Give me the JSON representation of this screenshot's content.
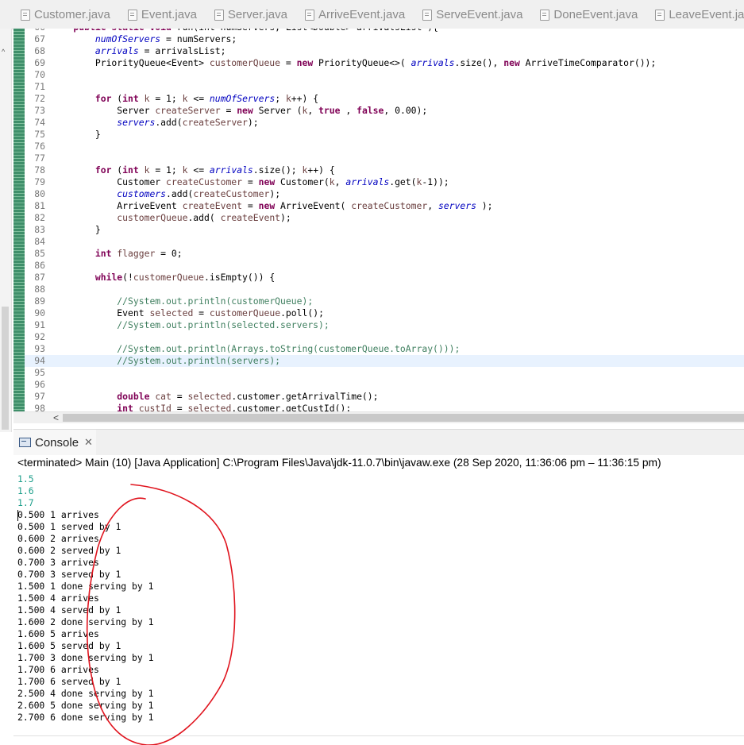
{
  "tabs": [
    {
      "label": "Customer.java",
      "icon": "java-file-icon"
    },
    {
      "label": "Event.java",
      "icon": "java-file-icon"
    },
    {
      "label": "Server.java",
      "icon": "java-file-icon"
    },
    {
      "label": "ArriveEvent.java",
      "icon": "java-file-icon"
    },
    {
      "label": "ServeEvent.java",
      "icon": "java-file-icon"
    },
    {
      "label": "DoneEvent.java",
      "icon": "java-file-icon"
    },
    {
      "label": "LeaveEvent.java",
      "icon": "java-file-icon"
    }
  ],
  "editor": {
    "highlighted_line": "94",
    "lines": [
      {
        "n": "66",
        "segs": [
          [
            "kw",
            "    public static void "
          ],
          [
            "",
            "run(int numServers, List<Double> arrivalsList ){"
          ]
        ]
      },
      {
        "n": "67",
        "segs": [
          [
            "",
            "        "
          ],
          [
            "fld",
            "numOfServers"
          ],
          [
            "",
            " = numServers;"
          ]
        ]
      },
      {
        "n": "68",
        "segs": [
          [
            "",
            "        "
          ],
          [
            "fld",
            "arrivals"
          ],
          [
            "",
            " = arrivalsList;"
          ]
        ]
      },
      {
        "n": "69",
        "segs": [
          [
            "",
            "        PriorityQueue<Event> "
          ],
          [
            "vr",
            "customerQueue"
          ],
          [
            "",
            " = "
          ],
          [
            "kw",
            "new"
          ],
          [
            "",
            " PriorityQueue<>( "
          ],
          [
            "fld",
            "arrivals"
          ],
          [
            "",
            ".size(), "
          ],
          [
            "kw",
            "new"
          ],
          [
            "",
            " ArriveTimeComparator());"
          ]
        ]
      },
      {
        "n": "70",
        "segs": []
      },
      {
        "n": "71",
        "segs": []
      },
      {
        "n": "72",
        "segs": [
          [
            "",
            "        "
          ],
          [
            "kw",
            "for"
          ],
          [
            "",
            " ("
          ],
          [
            "kw",
            "int"
          ],
          [
            "",
            " "
          ],
          [
            "vr",
            "k"
          ],
          [
            "",
            " = 1; "
          ],
          [
            "vr",
            "k"
          ],
          [
            "",
            " <= "
          ],
          [
            "fld",
            "numOfServers"
          ],
          [
            "",
            "; "
          ],
          [
            "vr",
            "k"
          ],
          [
            "",
            "++) {"
          ]
        ]
      },
      {
        "n": "73",
        "segs": [
          [
            "",
            "            Server "
          ],
          [
            "vr",
            "createServer"
          ],
          [
            "",
            " = "
          ],
          [
            "kw",
            "new"
          ],
          [
            "",
            " Server ("
          ],
          [
            "vr",
            "k"
          ],
          [
            "",
            ", "
          ],
          [
            "kw",
            "true"
          ],
          [
            "",
            " , "
          ],
          [
            "kw",
            "false"
          ],
          [
            "",
            ", 0.00);"
          ]
        ]
      },
      {
        "n": "74",
        "segs": [
          [
            "",
            "            "
          ],
          [
            "fld",
            "servers"
          ],
          [
            "",
            ".add("
          ],
          [
            "vr",
            "createServer"
          ],
          [
            "",
            ");"
          ]
        ]
      },
      {
        "n": "75",
        "segs": [
          [
            "",
            "        }"
          ]
        ]
      },
      {
        "n": "76",
        "segs": []
      },
      {
        "n": "77",
        "segs": []
      },
      {
        "n": "78",
        "segs": [
          [
            "",
            "        "
          ],
          [
            "kw",
            "for"
          ],
          [
            "",
            " ("
          ],
          [
            "kw",
            "int"
          ],
          [
            "",
            " "
          ],
          [
            "vr",
            "k"
          ],
          [
            "",
            " = 1; "
          ],
          [
            "vr",
            "k"
          ],
          [
            "",
            " <= "
          ],
          [
            "fld",
            "arrivals"
          ],
          [
            "",
            ".size(); "
          ],
          [
            "vr",
            "k"
          ],
          [
            "",
            "++) {"
          ]
        ]
      },
      {
        "n": "79",
        "segs": [
          [
            "",
            "            Customer "
          ],
          [
            "vr",
            "createCustomer"
          ],
          [
            "",
            " = "
          ],
          [
            "kw",
            "new"
          ],
          [
            "",
            " Customer("
          ],
          [
            "vr",
            "k"
          ],
          [
            "",
            ", "
          ],
          [
            "fld",
            "arrivals"
          ],
          [
            "",
            ".get("
          ],
          [
            "vr",
            "k"
          ],
          [
            "",
            "-1));"
          ]
        ]
      },
      {
        "n": "80",
        "segs": [
          [
            "",
            "            "
          ],
          [
            "fld",
            "customers"
          ],
          [
            "",
            ".add("
          ],
          [
            "vr",
            "createCustomer"
          ],
          [
            "",
            ");"
          ]
        ]
      },
      {
        "n": "81",
        "segs": [
          [
            "",
            "            ArriveEvent "
          ],
          [
            "vr",
            "createEvent"
          ],
          [
            "",
            " = "
          ],
          [
            "kw",
            "new"
          ],
          [
            "",
            " ArriveEvent( "
          ],
          [
            "vr",
            "createCustomer"
          ],
          [
            "",
            ", "
          ],
          [
            "fld",
            "servers"
          ],
          [
            "",
            " );"
          ]
        ]
      },
      {
        "n": "82",
        "segs": [
          [
            "",
            "            "
          ],
          [
            "vr",
            "customerQueue"
          ],
          [
            "",
            ".add( "
          ],
          [
            "vr",
            "createEvent"
          ],
          [
            "",
            ");"
          ]
        ]
      },
      {
        "n": "83",
        "segs": [
          [
            "",
            "        }"
          ]
        ]
      },
      {
        "n": "84",
        "segs": []
      },
      {
        "n": "85",
        "segs": [
          [
            "",
            "        "
          ],
          [
            "kw",
            "int"
          ],
          [
            "",
            " "
          ],
          [
            "vr",
            "flagger"
          ],
          [
            "",
            " = 0;"
          ]
        ]
      },
      {
        "n": "86",
        "segs": []
      },
      {
        "n": "87",
        "segs": [
          [
            "",
            "        "
          ],
          [
            "kw",
            "while"
          ],
          [
            "",
            "(!"
          ],
          [
            "vr",
            "customerQueue"
          ],
          [
            "",
            ".isEmpty()) {"
          ]
        ]
      },
      {
        "n": "88",
        "segs": []
      },
      {
        "n": "89",
        "segs": [
          [
            "",
            "            "
          ],
          [
            "cm",
            "//System.out.println(customerQueue);"
          ]
        ]
      },
      {
        "n": "90",
        "segs": [
          [
            "",
            "            Event "
          ],
          [
            "vr",
            "selected"
          ],
          [
            "",
            " = "
          ],
          [
            "vr",
            "customerQueue"
          ],
          [
            "",
            ".poll();"
          ]
        ]
      },
      {
        "n": "91",
        "segs": [
          [
            "",
            "            "
          ],
          [
            "cm",
            "//System.out.println(selected.servers);"
          ]
        ]
      },
      {
        "n": "92",
        "segs": []
      },
      {
        "n": "93",
        "segs": [
          [
            "",
            "            "
          ],
          [
            "cm",
            "//System.out.println(Arrays.toString(customerQueue.toArray()));"
          ]
        ]
      },
      {
        "n": "94",
        "segs": [
          [
            "",
            "            "
          ],
          [
            "cm",
            "//System.out.println(servers);"
          ]
        ]
      },
      {
        "n": "95",
        "segs": []
      },
      {
        "n": "96",
        "segs": []
      },
      {
        "n": "97",
        "segs": [
          [
            "",
            "            "
          ],
          [
            "kw",
            "double"
          ],
          [
            "",
            " "
          ],
          [
            "vr",
            "cat"
          ],
          [
            "",
            " = "
          ],
          [
            "vr",
            "selected"
          ],
          [
            "",
            ".customer.getArrivalTime();"
          ]
        ]
      },
      {
        "n": "98",
        "segs": [
          [
            "",
            "            "
          ],
          [
            "kw",
            "int"
          ],
          [
            "",
            " "
          ],
          [
            "vr",
            "custId"
          ],
          [
            "",
            " = "
          ],
          [
            "vr",
            "selected"
          ],
          [
            "",
            ".customer.getCustId();"
          ]
        ]
      }
    ]
  },
  "console": {
    "title": "Console",
    "close_glyph": "✕",
    "status": "<terminated> Main (10) [Java Application] C:\\Program Files\\Java\\jdk-11.0.7\\bin\\javaw.exe  (28 Sep 2020, 11:36:06 pm – 11:36:15 pm)",
    "input_lines": [
      "1.5",
      "1.6",
      "1.7"
    ],
    "output_lines": [
      "0.500 1 arrives",
      "0.500 1 served by 1",
      "0.600 2 arrives",
      "0.600 2 served by 1",
      "0.700 3 arrives",
      "0.700 3 served by 1",
      "1.500 1 done serving by 1",
      "1.500 4 arrives",
      "1.500 4 served by 1",
      "1.600 2 done serving by 1",
      "1.600 5 arrives",
      "1.600 5 served by 1",
      "1.700 3 done serving by 1",
      "1.700 6 arrives",
      "1.700 6 served by 1",
      "2.500 4 done serving by 1",
      "2.600 5 done serving by 1",
      "2.700 6 done serving by 1"
    ]
  },
  "colors": {
    "annotation": "#e0141e",
    "console_input": "#1c9e8a",
    "keyword": "#7f0055",
    "field": "#0000c0",
    "comment": "#3f7f5f"
  }
}
